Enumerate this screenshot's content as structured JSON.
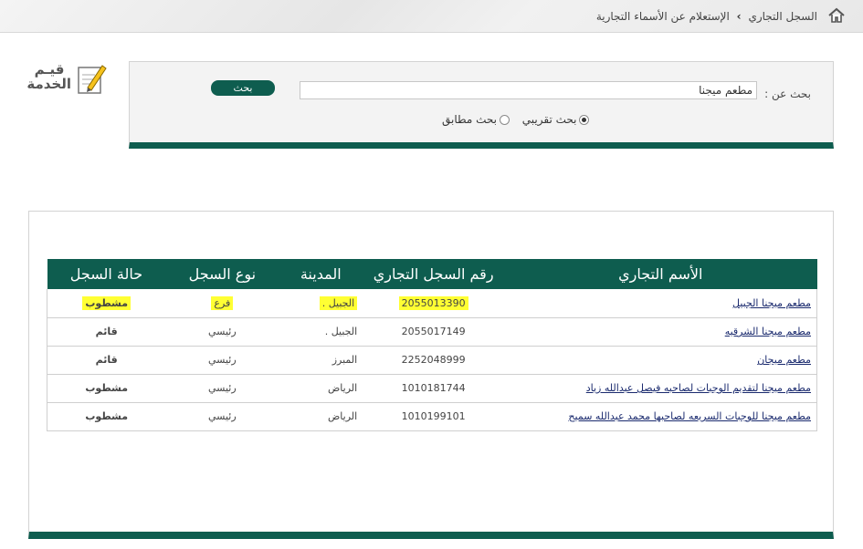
{
  "breadcrumb": {
    "home_icon": "home-icon",
    "items": [
      "السجل التجاري",
      "الإستعلام عن الأسماء التجارية"
    ],
    "separator": "›"
  },
  "rating": {
    "label_line1": "قيـم",
    "label_line2": "الخدمة",
    "icon": "pencil-note-icon"
  },
  "search": {
    "label": "بحث عن :",
    "value": "مطعم ميجنا",
    "button_label": "بحث",
    "options": [
      {
        "label": "بحث تقريبي",
        "selected": true
      },
      {
        "label": "بحث مطابق",
        "selected": false
      }
    ]
  },
  "table": {
    "headers": [
      "الأسم التجاري",
      "رقم السجل التجاري",
      "المدينة",
      "نوع السجل",
      "حالة السجل"
    ],
    "rows": [
      {
        "name": "مطعم ميجنا الجبيل",
        "number": "2055013390",
        "city": "الجبيل .",
        "type": "فرع",
        "status": "مشطوب",
        "status_color": "#cc0000",
        "highlighted": true
      },
      {
        "name": "مطعم ميجنا الشرقيه",
        "number": "2055017149",
        "city": "الجبيل .",
        "type": "رئيسي",
        "status": "قائم",
        "status_color": "#208a1a",
        "highlighted": false
      },
      {
        "name": "مطعم ميجان",
        "number": "2252048999",
        "city": "المبرز",
        "type": "رئيسي",
        "status": "قائم",
        "status_color": "#208a1a",
        "highlighted": false
      },
      {
        "name": "مطعم ميجنا لتقديم الوجبات لصاحبه فيصل عبدالله زياد",
        "number": "1010181744",
        "city": "الرياض",
        "type": "رئيسي",
        "status": "مشطوب",
        "status_color": "#cc0000",
        "highlighted": false
      },
      {
        "name": "مطعم ميجنا للوجبات السريعه لصاحبها محمد عبدالله سميح",
        "number": "1010199101",
        "city": "الرياض",
        "type": "رئيسي",
        "status": "مشطوب",
        "status_color": "#cc0000",
        "highlighted": false
      }
    ]
  },
  "colors": {
    "brand": "#0e5d4f",
    "highlight": "#ffff33",
    "status_struck": "#cc0000",
    "status_active": "#208a1a"
  }
}
